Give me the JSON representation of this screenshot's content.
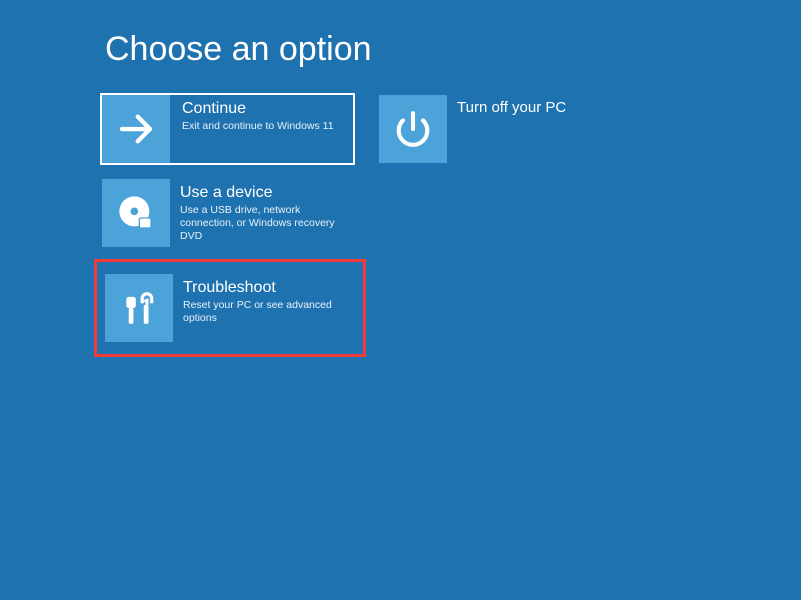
{
  "page_title": "Choose an option",
  "options": {
    "continue": {
      "title": "Continue",
      "desc": "Exit and continue to Windows 11"
    },
    "poweroff": {
      "title": "Turn off your PC"
    },
    "usedevice": {
      "title": "Use a device",
      "desc": "Use a USB drive, network connection, or Windows recovery DVD"
    },
    "troubleshoot": {
      "title": "Troubleshoot",
      "desc": "Reset your PC or see advanced options"
    }
  }
}
